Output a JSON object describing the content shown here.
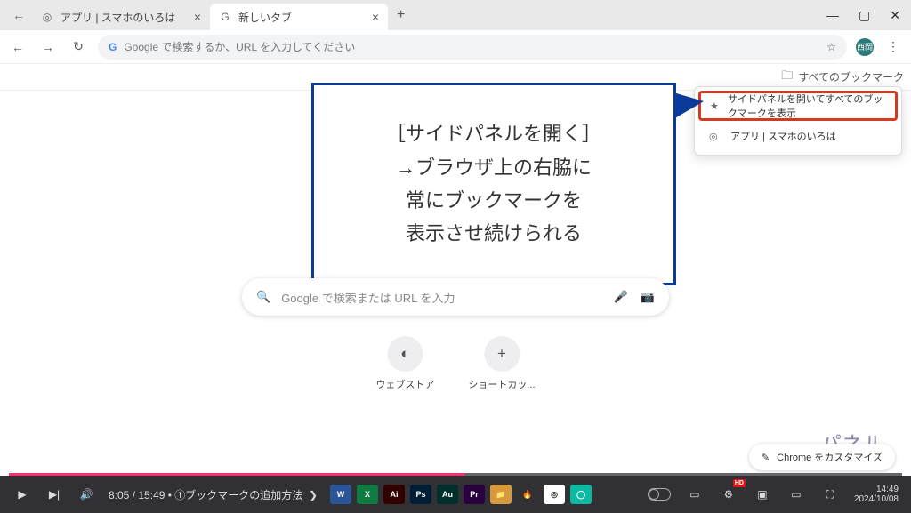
{
  "titlebar": {
    "tabs": [
      {
        "label": "アプリ | スマホのいろは",
        "active": false,
        "favicon": "◎"
      },
      {
        "label": "新しいタブ",
        "active": true,
        "favicon": "G"
      }
    ]
  },
  "toolbar": {
    "address_placeholder": "Google で検索するか、URL を入力してください",
    "avatar_initials": "西岡"
  },
  "bookmarks_bar": {
    "folder_label": "すべてのブックマーク"
  },
  "dropdown": {
    "items": [
      {
        "icon": "★",
        "label": "サイドパネルを開いてすべてのブックマークを表示",
        "highlight": true
      },
      {
        "icon": "◎",
        "label": "アプリ | スマホのいろは",
        "highlight": false
      }
    ]
  },
  "callout": {
    "line1": "［サイドパネルを開く］",
    "line2": "→ブラウザ上の右脇に",
    "line3": "常にブックマークを",
    "line4": "表示させ続けられる"
  },
  "ntp": {
    "search_placeholder": "Google で検索または URL を入力",
    "shortcuts": [
      {
        "label": "ウェブストア",
        "glyph": "◐"
      },
      {
        "label": "ショートカッ...",
        "glyph": "+"
      }
    ]
  },
  "customize_label": "Chrome をカスタマイズ",
  "scribble_text": "パネル",
  "video": {
    "current_time": "8:05",
    "duration": "15:49",
    "chapter": "①ブックマークの追加方法",
    "clock_time": "14:49",
    "clock_date": "2024/10/08",
    "hd_badge": "HD"
  },
  "app_tiles": [
    {
      "txt": "W",
      "bg": "#2a5699"
    },
    {
      "txt": "X",
      "bg": "#107c41"
    },
    {
      "txt": "Ai",
      "bg": "#330000"
    },
    {
      "txt": "Ps",
      "bg": "#001e36"
    },
    {
      "txt": "Au",
      "bg": "#00302b"
    },
    {
      "txt": "Pr",
      "bg": "#2a003f"
    },
    {
      "txt": "📁",
      "bg": "#d69a3c"
    },
    {
      "txt": "🔥",
      "bg": "transparent"
    },
    {
      "txt": "◎",
      "bg": "#ffffff"
    },
    {
      "txt": "◯",
      "bg": "#0cbaa1"
    }
  ]
}
